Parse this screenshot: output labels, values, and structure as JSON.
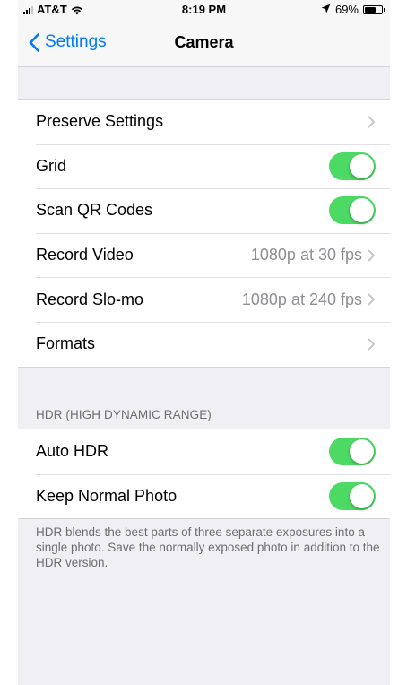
{
  "status_bar": {
    "carrier": "AT&T",
    "time": "8:19 PM",
    "battery_percent": "69%",
    "battery_level": 0.69
  },
  "nav": {
    "back_label": "Settings",
    "title": "Camera"
  },
  "general_rows": [
    {
      "label": "Preserve Settings",
      "type": "disclosure",
      "value": ""
    },
    {
      "label": "Grid",
      "type": "toggle",
      "on": true
    },
    {
      "label": "Scan QR Codes",
      "type": "toggle",
      "on": true
    },
    {
      "label": "Record Video",
      "type": "disclosure",
      "value": "1080p at 30 fps"
    },
    {
      "label": "Record Slo-mo",
      "type": "disclosure",
      "value": "1080p at 240 fps"
    },
    {
      "label": "Formats",
      "type": "disclosure",
      "value": ""
    }
  ],
  "hdr_section": {
    "header": "HDR (HIGH DYNAMIC RANGE)",
    "rows": [
      {
        "label": "Auto HDR",
        "type": "toggle",
        "on": true
      },
      {
        "label": "Keep Normal Photo",
        "type": "toggle",
        "on": true
      }
    ],
    "footer": "HDR blends the best parts of three separate exposures into a single photo. Save the normally exposed photo in addition to the HDR version."
  },
  "colors": {
    "accent": "#007aff",
    "toggle_on": "#4cd964",
    "background": "#efeff4"
  }
}
